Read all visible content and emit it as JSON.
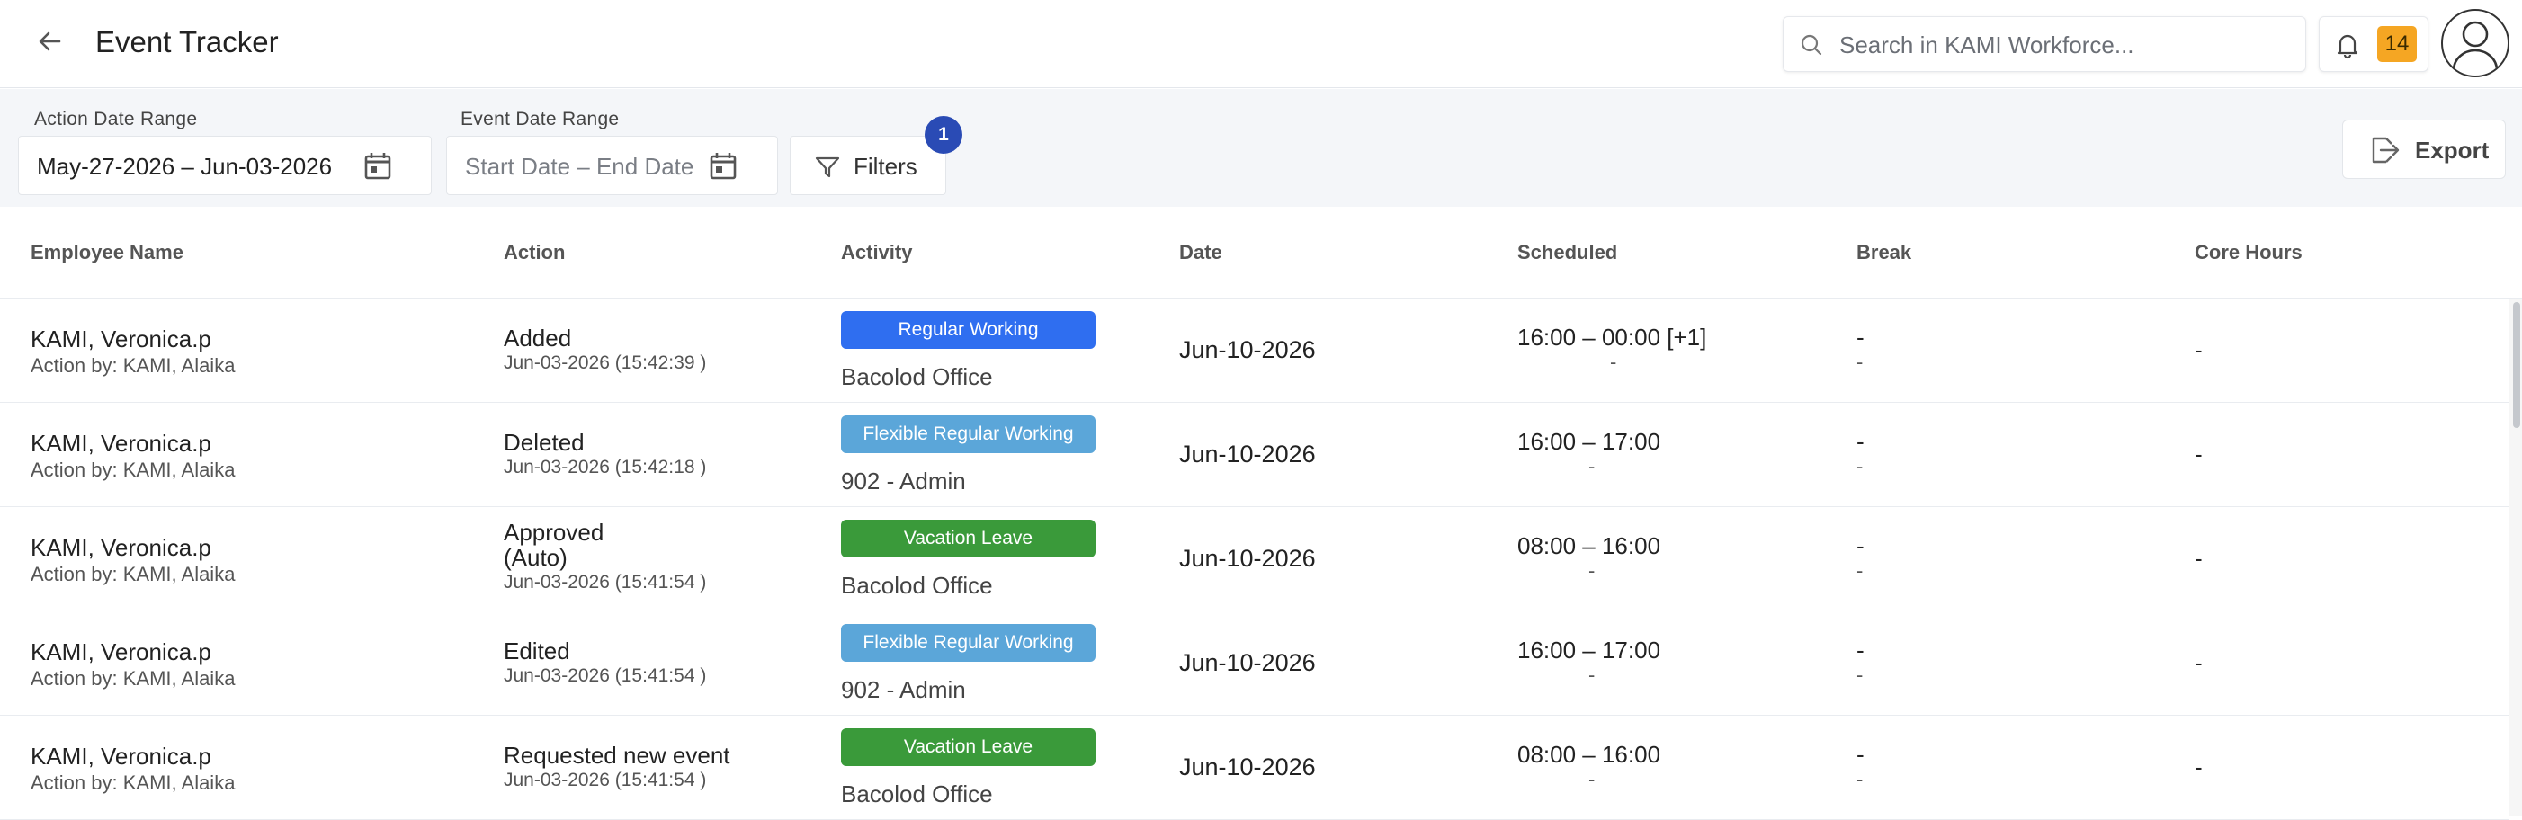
{
  "header": {
    "title": "Event Tracker",
    "back_icon": "arrow-left-icon",
    "search_placeholder": "Search in KAMI Workforce...",
    "notification_count": "14"
  },
  "filters": {
    "action_date_label": "Action Date Range",
    "action_date_value": "May-27-2026 – Jun-03-2026",
    "event_date_label": "Event Date Range",
    "event_date_placeholder": "Start Date – End Date",
    "filters_label": "Filters",
    "filters_badge": "1",
    "export_label": "Export"
  },
  "table": {
    "columns": [
      "Employee Name",
      "Action",
      "Activity",
      "Date",
      "Scheduled",
      "Break",
      "Core Hours"
    ],
    "rows": [
      {
        "employee": "KAMI, Veronica.p",
        "action_by": "Action by: KAMI, Alaika",
        "action": "Added",
        "action_time": "Jun-03-2026 (15:42:39 )",
        "activity": "Regular Working",
        "activity_color": "#2f6ef0",
        "location": "Bacolod Office",
        "date": "Jun-10-2026",
        "scheduled": "16:00 – 00:00 [+1]",
        "scheduled_sub": "-",
        "break": "-",
        "break_sub": "-",
        "core_hours": "-"
      },
      {
        "employee": "KAMI, Veronica.p",
        "action_by": "Action by: KAMI, Alaika",
        "action": "Deleted",
        "action_time": "Jun-03-2026 (15:42:18 )",
        "activity": "Flexible Regular Working",
        "activity_color": "#5ba6d9",
        "location": "902 - Admin",
        "date": "Jun-10-2026",
        "scheduled": "16:00 – 17:00",
        "scheduled_sub": "-",
        "break": "-",
        "break_sub": "-",
        "core_hours": "-"
      },
      {
        "employee": "KAMI, Veronica.p",
        "action_by": "Action by: KAMI, Alaika",
        "action": "Approved",
        "action_sub": "(Auto)",
        "action_time": "Jun-03-2026 (15:41:54 )",
        "activity": "Vacation Leave",
        "activity_color": "#3a9a3a",
        "location": "Bacolod Office",
        "date": "Jun-10-2026",
        "scheduled": "08:00 – 16:00",
        "scheduled_sub": "-",
        "break": "-",
        "break_sub": "-",
        "core_hours": "-"
      },
      {
        "employee": "KAMI, Veronica.p",
        "action_by": "Action by: KAMI, Alaika",
        "action": "Edited",
        "action_time": "Jun-03-2026 (15:41:54 )",
        "activity": "Flexible Regular Working",
        "activity_color": "#5ba6d9",
        "location": "902 - Admin",
        "date": "Jun-10-2026",
        "scheduled": "16:00 – 17:00",
        "scheduled_sub": "-",
        "break": "-",
        "break_sub": "-",
        "core_hours": "-"
      },
      {
        "employee": "KAMI, Veronica.p",
        "action_by": "Action by: KAMI, Alaika",
        "action": "Requested new event",
        "action_time": "Jun-03-2026 (15:41:54 )",
        "activity": "Vacation Leave",
        "activity_color": "#3a9a3a",
        "location": "Bacolod Office",
        "date": "Jun-10-2026",
        "scheduled": "08:00 – 16:00",
        "scheduled_sub": "-",
        "break": "-",
        "break_sub": "-",
        "core_hours": "-"
      }
    ]
  }
}
